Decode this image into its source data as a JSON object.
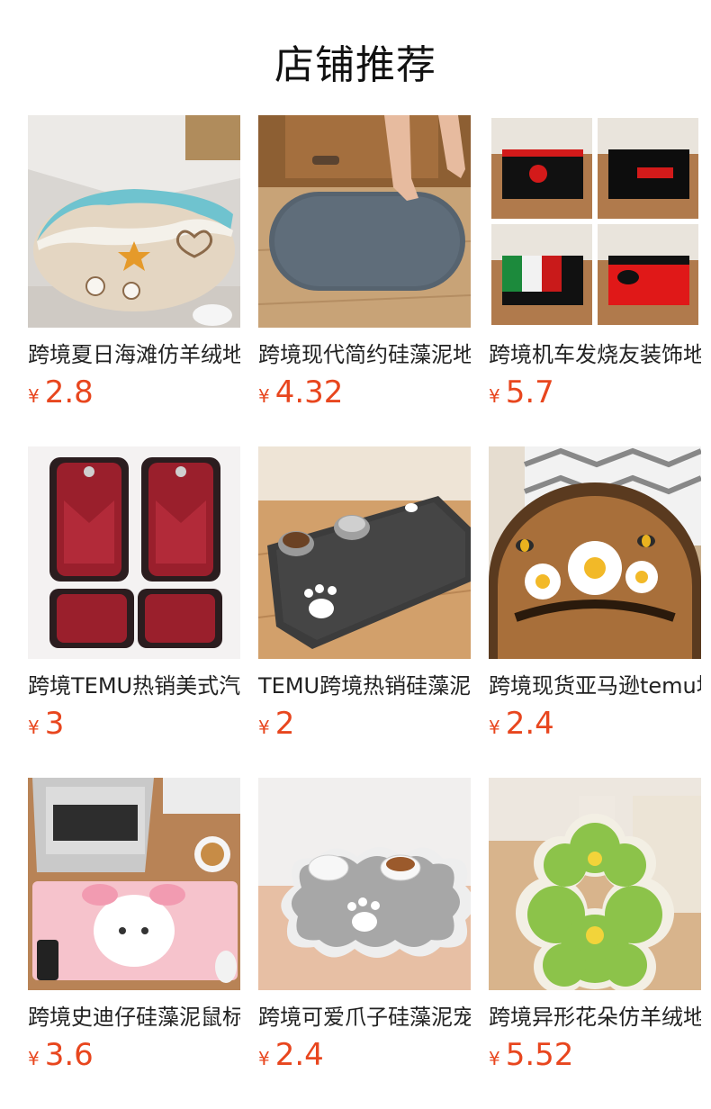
{
  "page": {
    "title": "店铺推荐"
  },
  "products": [
    {
      "name": "跨境夏日海滩仿羊绒地垫",
      "currency": "¥",
      "price": "2.8",
      "icon": "beach-bath-mat-image"
    },
    {
      "name": "跨境现代简约硅藻泥地垫",
      "currency": "¥",
      "price": "4.32",
      "icon": "diatomite-bath-mat-image"
    },
    {
      "name": "跨境机车发烧友装饰地垫",
      "currency": "¥",
      "price": "5.7",
      "icon": "motorbike-rug-set-image"
    },
    {
      "name": "跨境TEMU热销美式汽车脚垫",
      "currency": "¥",
      "price": "3",
      "icon": "car-seat-mat-set-image"
    },
    {
      "name": "TEMU跨境热销硅藻泥宠物垫",
      "currency": "¥",
      "price": "2",
      "icon": "pet-feeding-mat-image"
    },
    {
      "name": "跨境现货亚马逊temu地垫",
      "currency": "¥",
      "price": "2.4",
      "icon": "welcome-daisy-doormat-image"
    },
    {
      "name": "跨境史迪仔硅藻泥鼠标垫",
      "currency": "¥",
      "price": "3.6",
      "icon": "cartoon-desk-mat-image"
    },
    {
      "name": "跨境可爱爪子硅藻泥宠物垫",
      "currency": "¥",
      "price": "2.4",
      "icon": "paw-pet-bowl-mat-image"
    },
    {
      "name": "跨境异形花朵仿羊绒地毯",
      "currency": "¥",
      "price": "5.52",
      "icon": "flower-shaped-rug-image"
    }
  ],
  "colors": {
    "price": "#e8461e",
    "title": "#111111"
  }
}
